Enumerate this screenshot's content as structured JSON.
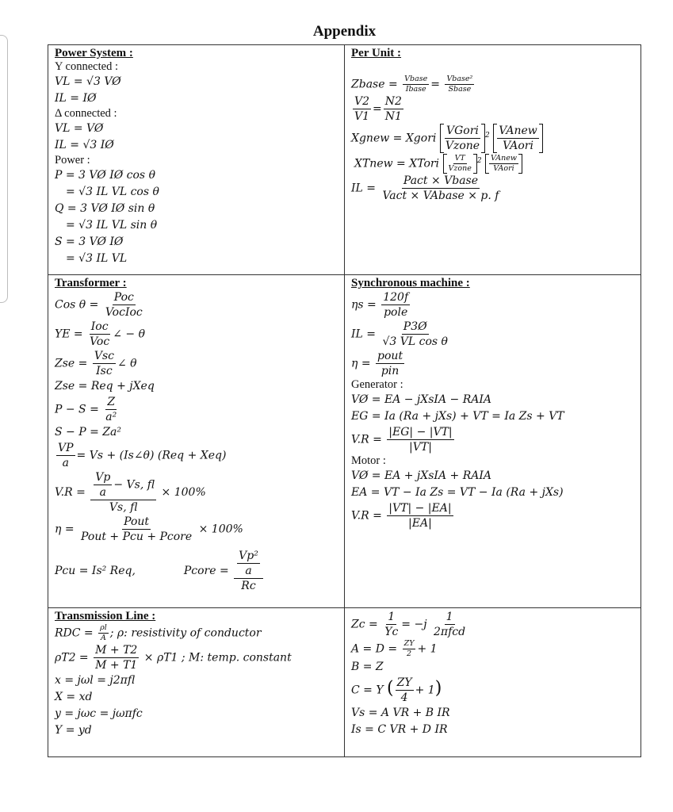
{
  "title": "Appendix",
  "power_system": {
    "heading": "Power System :",
    "y_label": "Y connected :",
    "y_vl": "VL = √3 VØ",
    "y_il": "IL = IØ",
    "d_label": "Δ connected :",
    "d_vl": "VL = VØ",
    "d_il": "IL = √3 IØ",
    "power_label": "Power :",
    "p1": "P = 3 VØ IØ cos θ",
    "p2": "= √3 IL VL cos θ",
    "q1": "Q = 3 VØ IØ sin θ",
    "q2": "= √3 IL VL sin θ",
    "s1": "S = 3 VØ IØ",
    "s2": "= √3 IL VL"
  },
  "per_unit": {
    "heading": "Per Unit :",
    "zbase_lhs": "Zbase =",
    "zbase_n1": "Vbase",
    "zbase_d1": "Ibase",
    "zbase_n2": "Vbase²",
    "zbase_d2": "Sbase",
    "ratio_n1": "V2",
    "ratio_d1": "V1",
    "ratio_n2": "N2",
    "ratio_d2": "N1",
    "xg_lhs": "Xgnew = Xgori",
    "xg_n1": "VGori",
    "xg_d1": "Vzone",
    "xg_n2": "VAnew",
    "xg_d2": "VAori",
    "xt_lhs": "XTnew = XTori",
    "xt_n1": "VT",
    "xt_d1": "Vzone",
    "xt_n2": "VAnew",
    "xt_d2": "VAori",
    "il_lhs": "IL =",
    "il_num": "Pact × Vbase",
    "il_den": "Vact × VAbase × p. f"
  },
  "transformer": {
    "heading": "Transformer :",
    "cos_lhs": "Cos θ =",
    "cos_num": "Poc",
    "cos_den": "VocIoc",
    "ye_lhs": "YE =",
    "ye_num": "Ioc",
    "ye_den": "Voc",
    "ye_tail": "∠ − θ",
    "zse_lhs": "Zse =",
    "zse_num": "Vsc",
    "zse_den": "Isc",
    "zse_tail": "∠ θ",
    "zse2": "Zse = Req + jXeq",
    "ps_lhs": "P − S =",
    "ps_num": "Z",
    "ps_den": "a²",
    "sp": "S − P = Za²",
    "vp_num": "VP",
    "vp_den": "a",
    "vp_tail": "= Vs + (Is∠θ) (Req + Xeq)",
    "vr_lhs": "V.R =",
    "vr_num_a": "Vp",
    "vr_num_b": "a",
    "vr_num_tail": "− Vs, fl",
    "vr_den": "Vs, fl",
    "vr_tail": "× 100%",
    "eta_lhs": "η =",
    "eta_num": "Pout",
    "eta_den": "Pout + Pcu + Pcore",
    "eta_tail": "× 100%",
    "pcu": "Pcu = Is² Req,",
    "pcore_lhs": "Pcore =",
    "pcore_num_a": "Vp²",
    "pcore_num_b": "a",
    "pcore_den": "Rc"
  },
  "synchronous": {
    "heading": "Synchronous machine :",
    "ns_lhs": "ηs =",
    "ns_num": "120f",
    "ns_den": "pole",
    "il_lhs": "IL =",
    "il_num": "P3Ø",
    "il_den": "√3 VL cos θ",
    "eta_lhs": "η =",
    "eta_num": "pout",
    "eta_den": "pin",
    "gen_label": "Generator :",
    "gen1": "VØ = EA − jXsIA − RAIA",
    "gen2": "EG = Ia (Ra + jXs) + VT = Ia Zs + VT",
    "gen_vr_lhs": "V.R =",
    "gen_vr_num": "|EG| − |VT|",
    "gen_vr_den": "|VT|",
    "mot_label": "Motor :",
    "mot1": "VØ = EA + jXsIA + RAIA",
    "mot2": "EA = VT − Ia Zs = VT − Ia (Ra + jXs)",
    "mot_vr_lhs": "V.R =",
    "mot_vr_num": "|VT| − |EA|",
    "mot_vr_den": "|EA|"
  },
  "transmission": {
    "heading": "Transmission Line :",
    "rdc_lhs": "RDC =",
    "rdc_num": "ρl",
    "rdc_den": "A",
    "rdc_tail": "; ρ: resistivity of conductor",
    "rho_lhs": "ρT2 =",
    "rho_num": "M + T2",
    "rho_den": "M + T1",
    "rho_tail": "× ρT1 ; M: temp. constant",
    "x1": "x = jωl = j2πfl",
    "x2": "X = xd",
    "y1": "y = jωc = jωπfc",
    "y2": "Y = yd"
  },
  "abcd": {
    "zc_lhs": "Zc =",
    "zc_n1": "1",
    "zc_d1": "Yc",
    "zc_mid": "= −j",
    "zc_n2": "1",
    "zc_d2": "2πfcd",
    "ad_lhs": "A = D =",
    "ad_num": "ZY",
    "ad_den": "2",
    "ad_tail": "+ 1",
    "b": "B = Z",
    "c_lhs": "C = Y",
    "c_num": "ZY",
    "c_den": "4",
    "c_tail": "+ 1",
    "vs": "Vs = A VR + B IR",
    "is": "Is = C VR + D IR"
  }
}
